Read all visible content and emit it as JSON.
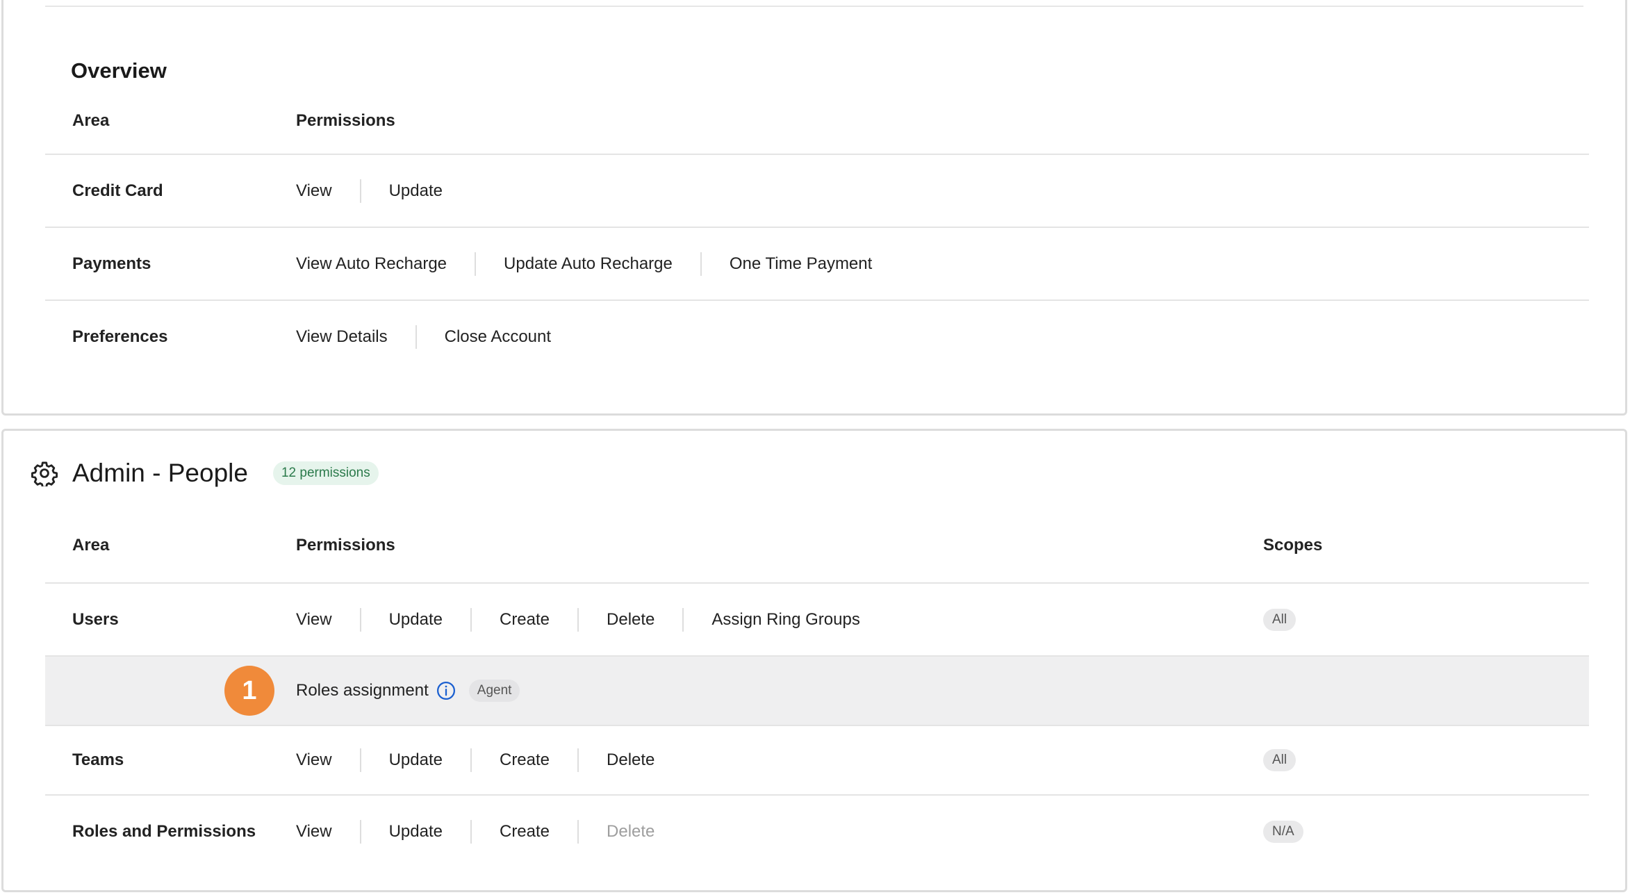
{
  "overview": {
    "title": "Overview",
    "headers": {
      "area": "Area",
      "permissions": "Permissions"
    },
    "rows": [
      {
        "area": "Credit Card",
        "permissions": [
          "View",
          "Update"
        ]
      },
      {
        "area": "Payments",
        "permissions": [
          "View Auto Recharge",
          "Update Auto Recharge",
          "One Time Payment"
        ]
      },
      {
        "area": "Preferences",
        "permissions": [
          "View Details",
          "Close Account"
        ]
      }
    ]
  },
  "admin_people": {
    "title": "Admin - People",
    "count_badge": "12 permissions",
    "headers": {
      "area": "Area",
      "permissions": "Permissions",
      "scopes": "Scopes"
    },
    "rows": [
      {
        "area": "Users",
        "permissions": [
          "View",
          "Update",
          "Create",
          "Delete",
          "Assign Ring Groups"
        ],
        "scope": "All"
      },
      {
        "area": "Teams",
        "permissions": [
          "View",
          "Update",
          "Create",
          "Delete"
        ],
        "scope": "All"
      },
      {
        "area": "Roles and Permissions",
        "permissions": [
          "View",
          "Update",
          "Create",
          "Delete"
        ],
        "disabled_permissions": [
          "Delete"
        ],
        "scope": "N/A"
      }
    ],
    "subrow": {
      "marker": "1",
      "label": "Roles assignment",
      "badge": "Agent"
    }
  },
  "colors": {
    "marker": "#f08a3a",
    "badge_green_bg": "#e6f4ec",
    "badge_green_text": "#2b7a4b",
    "info_icon": "#1a5fd0",
    "subrow_bg": "#efeff0"
  },
  "icons": {
    "section": "gear-icon",
    "info": "info-icon"
  }
}
